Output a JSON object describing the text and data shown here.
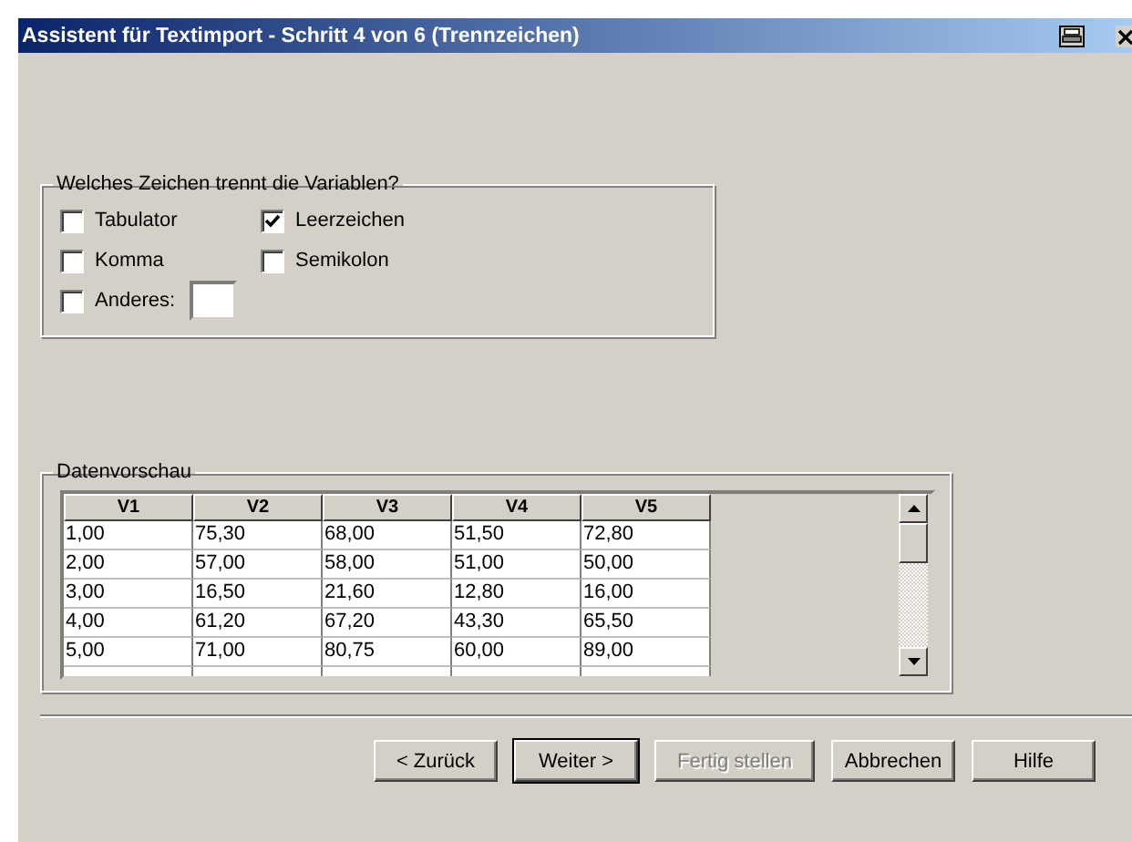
{
  "window": {
    "title": "Assistent für Textimport - Schritt 4 von 6 (Trennzeichen)"
  },
  "separators": {
    "legend": "Welches Zeichen trennt die Variablen?",
    "options": [
      {
        "kind": "checkbox",
        "label": "Tabulator",
        "checked": false
      },
      {
        "kind": "checkbox",
        "label": "Leerzeichen",
        "checked": true
      },
      {
        "kind": "checkbox",
        "label": "Komma",
        "checked": false
      },
      {
        "kind": "checkbox",
        "label": "Semikolon",
        "checked": false
      },
      {
        "kind": "checkbox_field",
        "label": "Anderes:",
        "checked": false
      }
    ]
  },
  "preview": {
    "legend": "Datenvorschau",
    "columns": [
      "V1",
      "V2",
      "V3",
      "V4",
      "V5"
    ],
    "rows": [
      [
        "1,00",
        "75,30",
        "68,00",
        "51,50",
        "72,80"
      ],
      [
        "2,00",
        "57,00",
        "58,00",
        "51,00",
        "50,00"
      ],
      [
        "3,00",
        "16,50",
        "21,60",
        "12,80",
        "16,00"
      ],
      [
        "4,00",
        "61,20",
        "67,20",
        "43,30",
        "65,50"
      ],
      [
        "5,00",
        "71,00",
        "80,75",
        "60,00",
        "89,00"
      ]
    ]
  },
  "buttons": [
    {
      "label": "< Zurück",
      "disabled": false,
      "default": false
    },
    {
      "label": "Weiter >",
      "disabled": false,
      "default": true
    },
    {
      "label": "Fertig stellen",
      "disabled": true,
      "default": false
    },
    {
      "label": "Abbrechen",
      "disabled": false,
      "default": false
    },
    {
      "label": "Hilfe",
      "disabled": false,
      "default": false
    }
  ]
}
